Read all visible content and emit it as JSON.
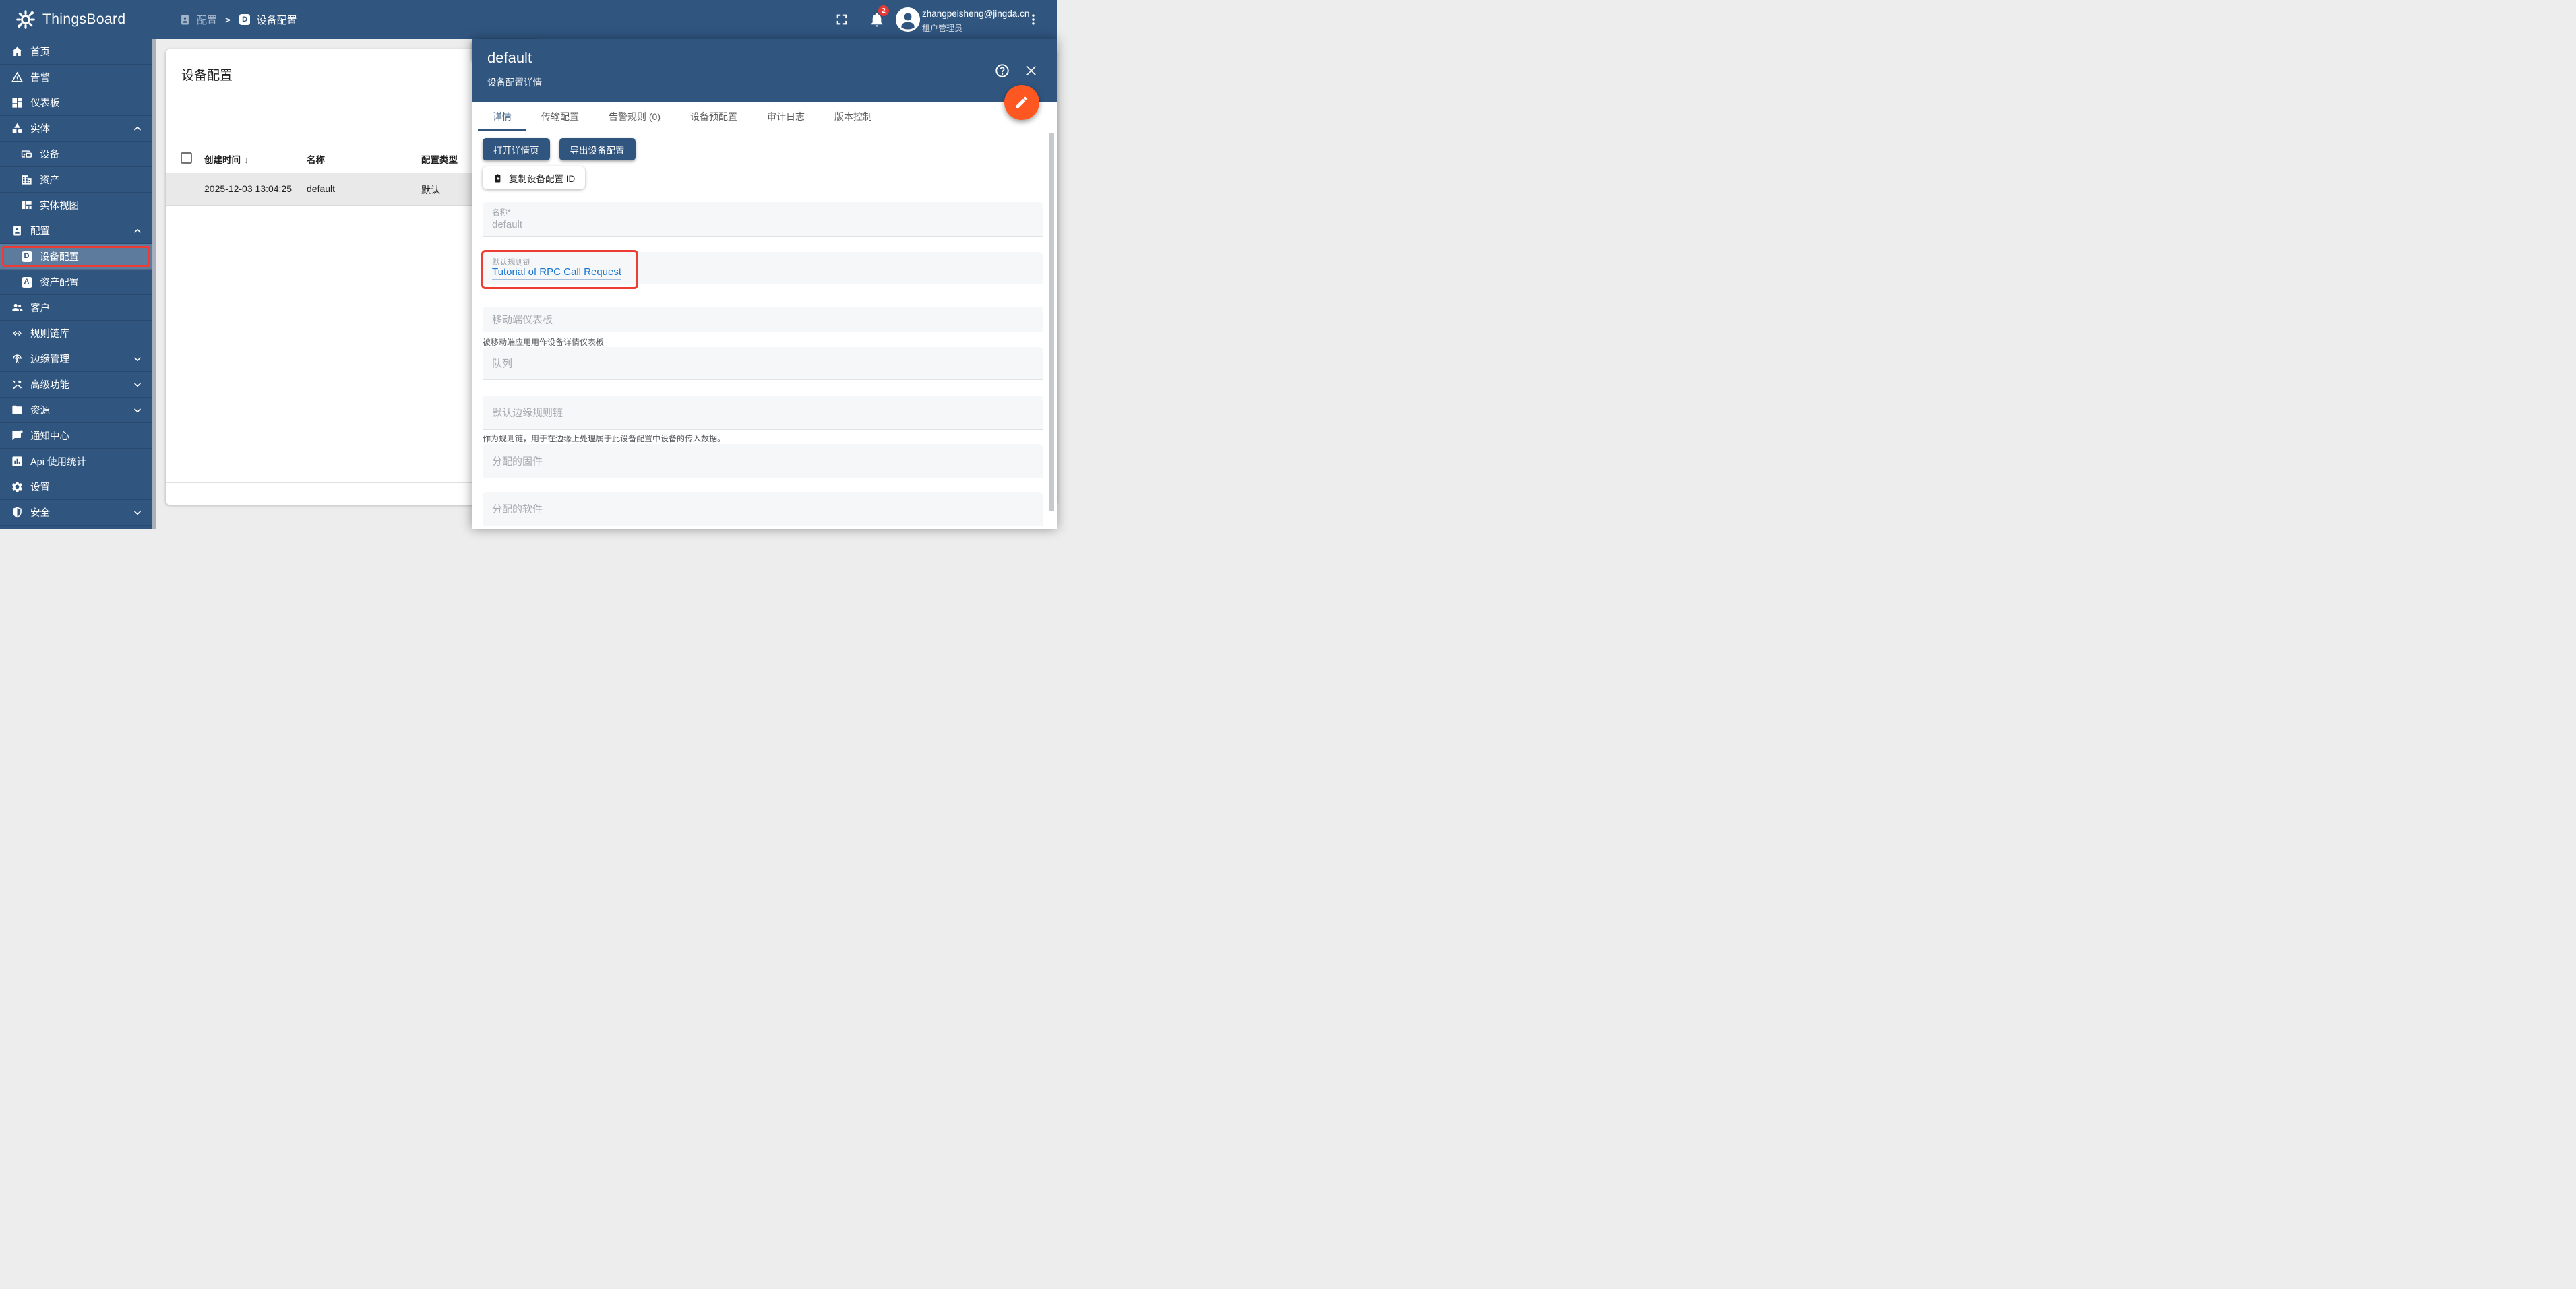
{
  "colors": {
    "primary_blue": "#305680",
    "accent_orange": "#ff5722",
    "annotation_red": "#ee3b33",
    "link_blue": "#1976d2",
    "badge_red": "#e53935",
    "selected_row_grey": "#e9e9e9"
  },
  "header": {
    "logo_text": "ThingsBoard",
    "breadcrumb": [
      {
        "label": "配置",
        "icon": "badge-icon",
        "muted": true
      },
      {
        "label": "设备配置",
        "icon": "device-profile-icon",
        "muted": false
      }
    ],
    "notification_count": "2",
    "user": {
      "email": "zhangpeisheng@jingda.cn",
      "role": "租户管理员"
    }
  },
  "sidebar": {
    "items": [
      {
        "name": "home",
        "label": "首页",
        "icon": "home-icon"
      },
      {
        "name": "alarms",
        "label": "告警",
        "icon": "alarm-icon"
      },
      {
        "name": "dashboards",
        "label": "仪表板",
        "icon": "dashboards-icon"
      },
      {
        "name": "entities",
        "label": "实体",
        "icon": "entities-icon",
        "chevron": "up"
      },
      {
        "name": "devices",
        "label": "设备",
        "icon": "devices-icon",
        "sub": true
      },
      {
        "name": "assets",
        "label": "资产",
        "icon": "assets-icon",
        "sub": true
      },
      {
        "name": "entity-views",
        "label": "实体视图",
        "icon": "entity-views-icon",
        "sub": true
      },
      {
        "name": "profiles",
        "label": "配置",
        "icon": "badge-icon",
        "chevron": "up"
      },
      {
        "name": "device-profiles",
        "label": "设备配置",
        "icon": "device-profile-icon",
        "sub": true,
        "active": true,
        "annotated": true
      },
      {
        "name": "asset-profiles",
        "label": "资产配置",
        "icon": "asset-profile-icon",
        "sub": true
      },
      {
        "name": "customers",
        "label": "客户",
        "icon": "customers-icon"
      },
      {
        "name": "rule-chains",
        "label": "规则链库",
        "icon": "rule-chains-icon"
      },
      {
        "name": "edge-management",
        "label": "边缘管理",
        "icon": "edge-icon",
        "chevron": "down"
      },
      {
        "name": "advanced-features",
        "label": "高级功能",
        "icon": "advanced-icon",
        "chevron": "down"
      },
      {
        "name": "resources",
        "label": "资源",
        "icon": "resources-icon",
        "chevron": "down"
      },
      {
        "name": "notification-center",
        "label": "通知中心",
        "icon": "notifications-icon"
      },
      {
        "name": "api-usage",
        "label": "Api 使用统计",
        "icon": "api-icon"
      },
      {
        "name": "settings",
        "label": "设置",
        "icon": "settings-icon"
      },
      {
        "name": "security",
        "label": "安全",
        "icon": "security-icon",
        "chevron": "down"
      }
    ]
  },
  "table": {
    "title": "设备配置",
    "columns": [
      "创建时间",
      "名称",
      "配置类型"
    ],
    "sort_column": "创建时间",
    "sort_direction": "↓",
    "rows": [
      {
        "created_time": "2025-12-03 13:04:25",
        "name": "default",
        "type": "默认"
      }
    ]
  },
  "panel": {
    "title": "default",
    "subtitle": "设备配置详情",
    "tabs": [
      {
        "name": "details",
        "label": "详情",
        "active": true
      },
      {
        "name": "transport",
        "label": "传输配置"
      },
      {
        "name": "alarm-rules",
        "label": "告警规则 (0)"
      },
      {
        "name": "device-provisioning",
        "label": "设备预配置"
      },
      {
        "name": "audit-logs",
        "label": "审计日志"
      },
      {
        "name": "version-control",
        "label": "版本控制"
      }
    ],
    "buttons": {
      "open_details": "打开详情页",
      "export_profile": "导出设备配置",
      "copy_id": "复制设备配置 ID"
    },
    "fields": {
      "name": {
        "label": "名称*",
        "value": "default"
      },
      "default_rule_chain": {
        "label": "默认规则链",
        "value": "Tutorial of RPC Call Request"
      },
      "mobile_dashboard": {
        "placeholder": "移动端仪表板",
        "hint": "被移动端应用用作设备详情仪表板"
      },
      "queue": {
        "placeholder": "队列"
      },
      "default_edge_rule_chain": {
        "placeholder": "默认边缘规则链",
        "hint": "作为规则链，用于在边缘上处理属于此设备配置中设备的传入数据。"
      },
      "assigned_firmware": {
        "placeholder": "分配的固件"
      },
      "assigned_software": {
        "placeholder": "分配的软件"
      }
    }
  }
}
